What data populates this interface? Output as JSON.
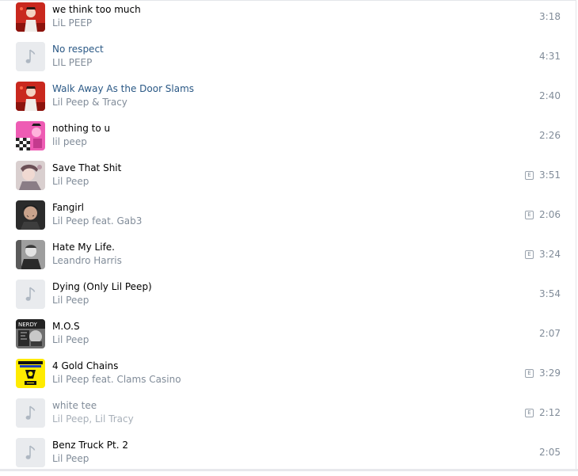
{
  "tracks": [
    {
      "title": "we think too much",
      "artist": "LiL PEEP",
      "duration": "3:18",
      "cover": "cover-red",
      "explicit": false,
      "title_style": "normal"
    },
    {
      "title": "No respect",
      "artist": "LIL PEEP",
      "duration": "4:31",
      "cover": "placeholder",
      "explicit": false,
      "title_style": "link"
    },
    {
      "title": "Walk Away As the Door Slams",
      "artist": "Lil Peep & Tracy",
      "duration": "2:40",
      "cover": "cover-red",
      "explicit": false,
      "title_style": "link"
    },
    {
      "title": "nothing to u",
      "artist": "lil peep",
      "duration": "2:26",
      "cover": "cover-pink",
      "explicit": false,
      "title_style": "normal"
    },
    {
      "title": "Save That Shit",
      "artist": "Lil Peep",
      "duration": "3:51",
      "cover": "cover-photo-light",
      "explicit": true,
      "title_style": "normal"
    },
    {
      "title": "Fangirl",
      "artist": "Lil Peep feat. Gab3",
      "duration": "2:06",
      "cover": "cover-photo-dark",
      "explicit": true,
      "title_style": "normal"
    },
    {
      "title": "Hate My Life.",
      "artist": "Leandro Harris",
      "duration": "3:24",
      "cover": "cover-bw",
      "explicit": true,
      "title_style": "normal"
    },
    {
      "title": "Dying (Only Lil Peep)",
      "artist": "Lil Peep",
      "duration": "3:54",
      "cover": "placeholder",
      "explicit": false,
      "title_style": "normal"
    },
    {
      "title": "M.O.S",
      "artist": "Lil Peep",
      "duration": "2:07",
      "cover": "cover-collage",
      "explicit": false,
      "title_style": "normal"
    },
    {
      "title": "4 Gold Chains",
      "artist": "Lil Peep feat. Clams Casino",
      "duration": "3:29",
      "cover": "cover-yellow",
      "explicit": true,
      "title_style": "normal"
    },
    {
      "title": "white tee",
      "artist": "Lil Peep, Lil Tracy",
      "duration": "2:12",
      "cover": "placeholder",
      "explicit": true,
      "title_style": "muted"
    },
    {
      "title": "Benz Truck Pt. 2",
      "artist": "Lil Peep",
      "duration": "2:05",
      "cover": "placeholder",
      "explicit": false,
      "title_style": "normal"
    }
  ],
  "explicit_label": "E",
  "colors": {
    "title": "#000000",
    "title_link": "#2a5885",
    "secondary": "#818c99",
    "placeholder_bg": "#e9ebee",
    "placeholder_icon": "#aeb7c2"
  }
}
